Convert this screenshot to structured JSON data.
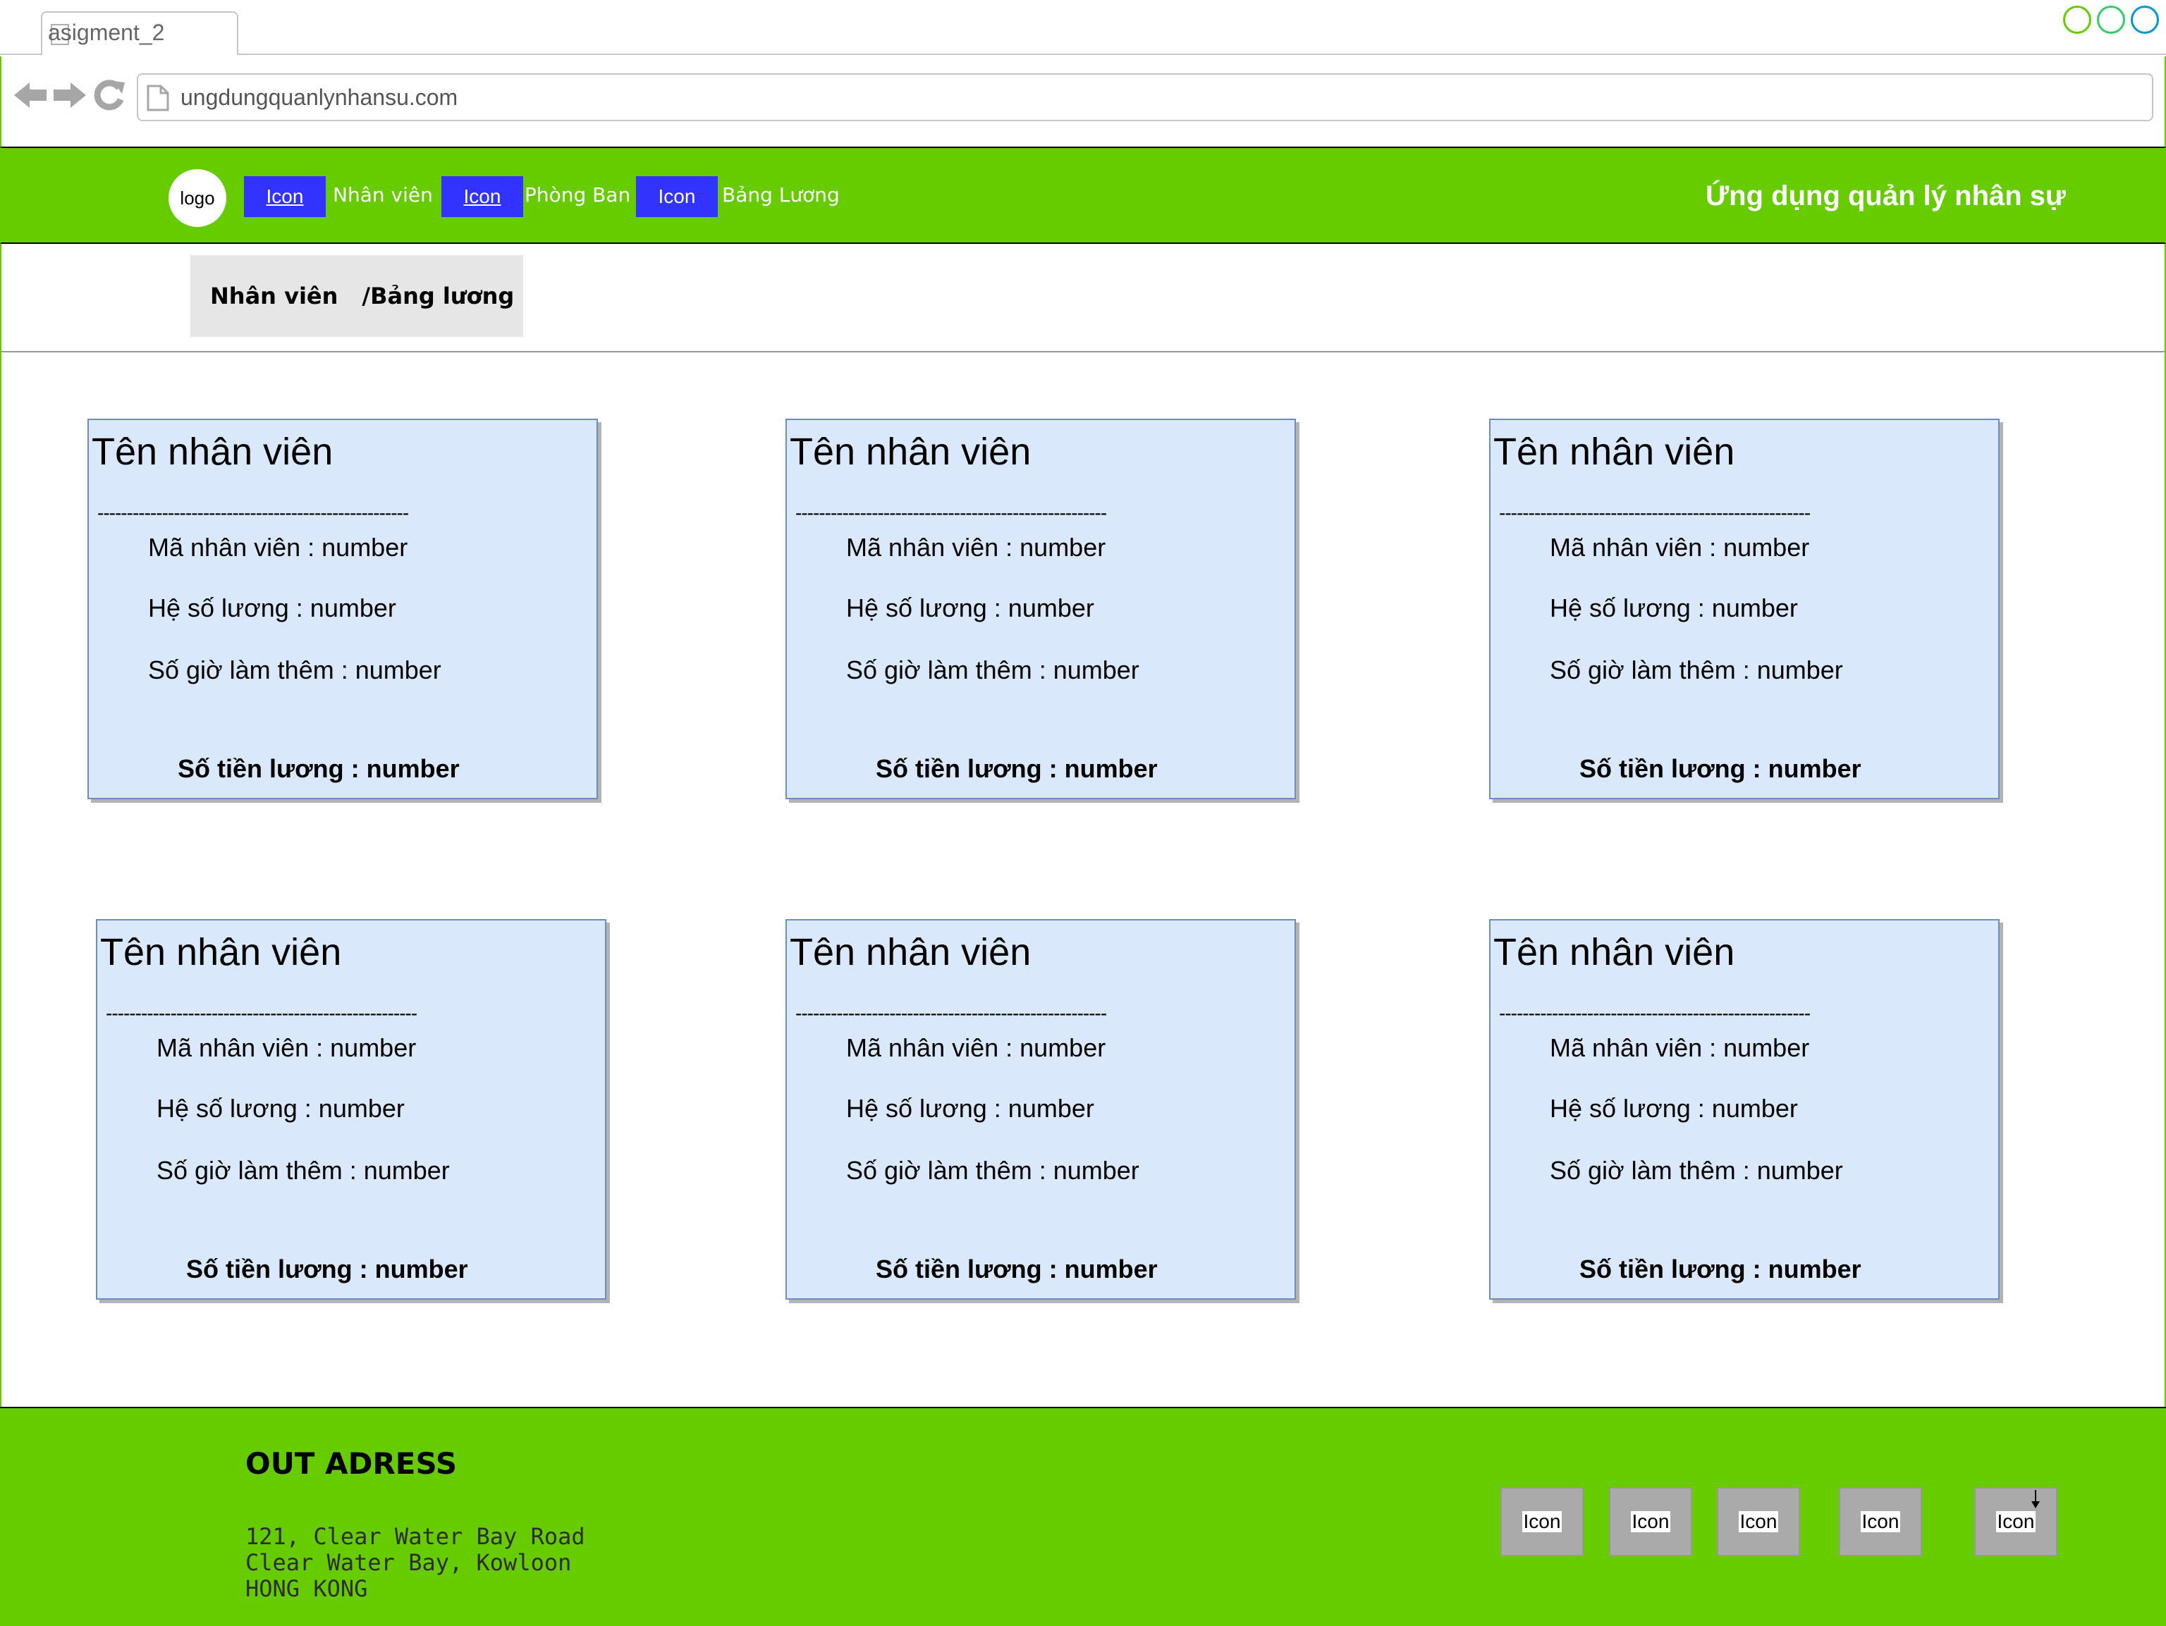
{
  "browser": {
    "tab_title": "asigment_2",
    "url": "ungdungquanlynhansu.com",
    "window_dot_colors": [
      "#66cc00",
      "#33cc66",
      "#0099cc"
    ]
  },
  "header": {
    "logo": "logo",
    "nav": [
      {
        "icon": "Icon",
        "label": "Nhân viên"
      },
      {
        "icon": "Icon",
        "label": "Phòng Ban"
      },
      {
        "icon": "Icon",
        "label": "Bảng Lương"
      }
    ],
    "title": "Ứng dụng quản lý nhân sự"
  },
  "breadcrumb": {
    "first": "Nhân viên",
    "second": "/Bảng lương"
  },
  "cards": [
    {
      "name": "Tên nhân viên",
      "divider": "-----------------------------------------------------",
      "ma": "Mã nhân viên : number",
      "he_so": "Hệ số lương : number",
      "gio": "Số giờ làm thêm : number",
      "tien": "Số tiền lương : number"
    },
    {
      "name": "Tên nhân viên",
      "divider": "-----------------------------------------------------",
      "ma": "Mã nhân viên : number",
      "he_so": "Hệ số lương : number",
      "gio": "Số giờ làm thêm : number",
      "tien": "Số tiền lương : number"
    },
    {
      "name": "Tên nhân viên",
      "divider": "-----------------------------------------------------",
      "ma": "Mã nhân viên : number",
      "he_so": "Hệ số lương : number",
      "gio": "Số giờ làm thêm : number",
      "tien": "Số tiền lương : number"
    },
    {
      "name": "Tên nhân viên",
      "divider": "-----------------------------------------------------",
      "ma": "Mã nhân viên : number",
      "he_so": "Hệ số lương : number",
      "gio": "Số giờ làm thêm : number",
      "tien": "Số tiền lương : number"
    },
    {
      "name": "Tên nhân viên",
      "divider": "-----------------------------------------------------",
      "ma": "Mã nhân viên : number",
      "he_so": "Hệ số lương : number",
      "gio": "Số giờ làm thêm : number",
      "tien": "Số tiền lương : number"
    },
    {
      "name": "Tên nhân viên",
      "divider": "-----------------------------------------------------",
      "ma": "Mã nhân viên : number",
      "he_so": "Hệ số lương : number",
      "gio": "Số giờ làm thêm : number",
      "tien": "Số tiền lương : number"
    }
  ],
  "footer": {
    "heading": "OUT ADRESS",
    "address": [
      "121, Clear Water Bay Road",
      "Clear Water Bay, Kowloon",
      "HONG KONG"
    ],
    "icons": [
      "Icon",
      "Icon",
      "Icon",
      "Icon",
      "Icon"
    ]
  },
  "colors": {
    "header_green": "#66cc00",
    "nav_icon_blue": "#3333ff",
    "card_fill": "#dae8fc",
    "card_border": "#6c8ebf"
  }
}
